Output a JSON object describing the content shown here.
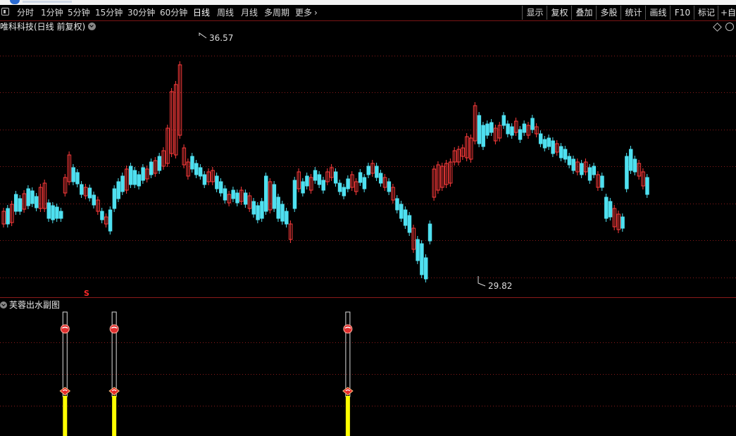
{
  "toolbar": {
    "periods": [
      {
        "label": "分时"
      },
      {
        "label": "1分钟"
      },
      {
        "label": "5分钟"
      },
      {
        "label": "15分钟"
      },
      {
        "label": "30分钟"
      },
      {
        "label": "60分钟"
      },
      {
        "label": "日线",
        "active": true
      },
      {
        "label": "周线"
      },
      {
        "label": "月线"
      },
      {
        "label": "多周期"
      },
      {
        "label": "更多"
      }
    ],
    "more_chevron": "›",
    "right_buttons": [
      "显示",
      "复权",
      "叠加",
      "多股",
      "统计",
      "画线",
      "F10",
      "标记",
      "+自选"
    ]
  },
  "stock": {
    "title": "唯科科技(日线 前复权)"
  },
  "indicator": {
    "title": "芙蓉出水副图"
  },
  "colors": {
    "up": "#ff3b3b",
    "down": "#4fe0f0",
    "grid": "#8a1a1a",
    "signal_bar": "#ffff00"
  },
  "chart_data": {
    "type": "candlestick",
    "price_range": [
      29.82,
      36.57
    ],
    "high_label": "36.57",
    "low_label": "29.82",
    "marker_label": "S",
    "signals": [
      {
        "index": 15
      },
      {
        "index": 27
      },
      {
        "index": 84
      }
    ]
  }
}
